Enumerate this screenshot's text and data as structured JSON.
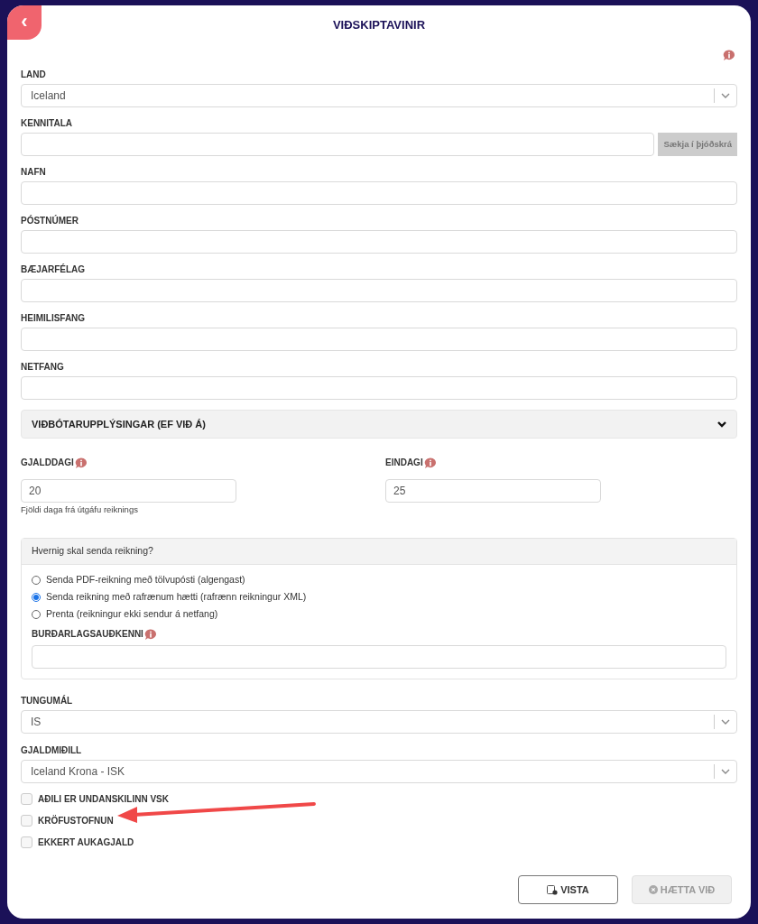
{
  "title": "VIÐSKIPTAVINIR",
  "back_button": {
    "label": "‹"
  },
  "fields": [
    {
      "kind": "select",
      "label": "LAND",
      "value": "Iceland"
    },
    {
      "kind": "text_button",
      "label": "KENNITALA",
      "button": "Sækja í þjóðskrá"
    },
    {
      "kind": "text",
      "label": "NAFN"
    },
    {
      "kind": "text",
      "label": "PÓSTNÚMER"
    },
    {
      "kind": "text",
      "label": "BÆJARFÉLAG"
    },
    {
      "kind": "text",
      "label": "HEIMILISFANG"
    },
    {
      "kind": "text",
      "label": "NETFANG"
    }
  ],
  "section": {
    "title": "VIÐBÓTARUPPLÝSINGAR (EF VIÐ Á)",
    "expanded": true
  },
  "due_fields": [
    {
      "label": "GJALDDAGI",
      "value": "20",
      "help": "Fjöldi daga frá útgáfu reiknings"
    },
    {
      "label": "EINDAGI",
      "value": "25"
    }
  ],
  "delivery": {
    "heading": "Hvernig skal senda reikning?",
    "options": [
      {
        "label": "Senda PDF-reikning með tölvupósti (algengast)",
        "selected": false
      },
      {
        "label": "Senda reikning með rafrænum hætti (rafrænn reikningur XML)",
        "selected": true
      },
      {
        "label": "Prenta (reikningur ekki sendur á netfang)",
        "selected": false
      }
    ],
    "field_label": "BURÐARLAGSAUÐKENNI"
  },
  "selects": [
    {
      "label": "TUNGUMÁL",
      "value": "IS"
    },
    {
      "label": "GJALDMIÐILL",
      "value": "Iceland Krona - ISK"
    }
  ],
  "checkboxes": [
    {
      "label": "AÐILI ER UNDANSKILINN VSK",
      "checked": false
    },
    {
      "label": "KRÖFUSTOFNUN",
      "checked": false
    },
    {
      "label": "EKKERT AUKAGJALD",
      "checked": false
    }
  ],
  "buttons": [
    {
      "label": "VISTA",
      "disabled": false
    },
    {
      "label": "HÆTTA VIÐ",
      "disabled": true
    }
  ]
}
